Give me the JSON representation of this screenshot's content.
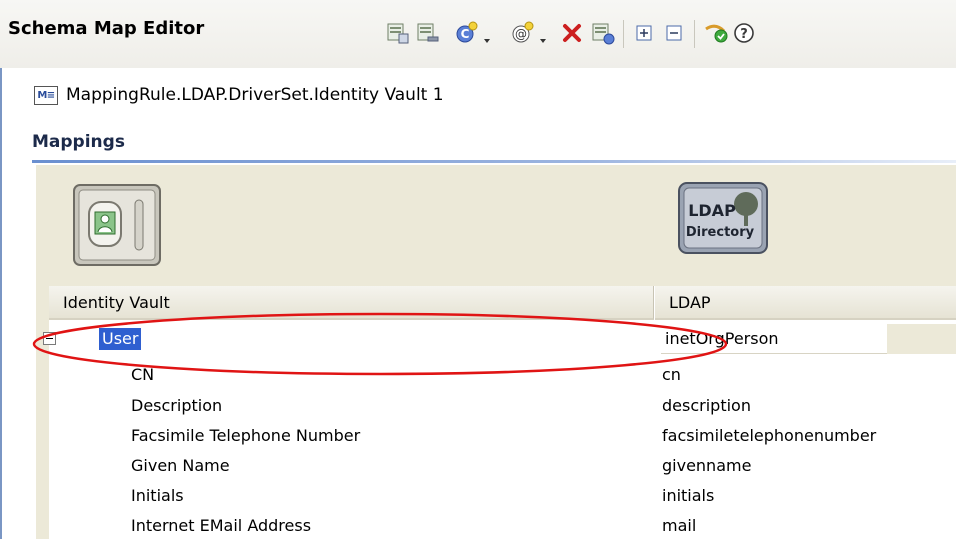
{
  "window": {
    "title": "Schema Map Editor"
  },
  "toolbar": {
    "buttons": [
      {
        "name": "add-class-mapping",
        "icon": "schema-add-icon"
      },
      {
        "name": "remove-class-mapping",
        "icon": "schema-remove-icon"
      },
      {
        "name": "add-class",
        "icon": "class-add-icon"
      },
      {
        "name": "add-attribute",
        "icon": "attribute-add-icon"
      },
      {
        "name": "delete",
        "icon": "delete-icon"
      },
      {
        "name": "refresh-schema",
        "icon": "schema-refresh-icon"
      },
      {
        "name": "expand-all",
        "icon": "plus-box-icon"
      },
      {
        "name": "collapse-all",
        "icon": "minus-box-icon"
      },
      {
        "name": "test-mapping",
        "icon": "check-icon"
      },
      {
        "name": "help",
        "icon": "help-icon"
      }
    ],
    "colors": {
      "delete": "#cc1f1f",
      "help_border": "#3a3a3a"
    }
  },
  "rule": {
    "icon_label": "M≡",
    "name": "MappingRule.LDAP.DriverSet.Identity Vault 1"
  },
  "section": {
    "title": "Mappings"
  },
  "ldap_icon": {
    "line1": "LDAP",
    "line2": "Directory"
  },
  "table": {
    "columns": [
      "Identity Vault",
      "LDAP"
    ],
    "class_row": {
      "vault": "User",
      "ldap": "inetOrgPerson"
    },
    "rows": [
      {
        "vault": "CN",
        "ldap": "cn"
      },
      {
        "vault": "Description",
        "ldap": "description"
      },
      {
        "vault": "Facsimile Telephone Number",
        "ldap": "facsimiletelephonenumber"
      },
      {
        "vault": "Given Name",
        "ldap": "givenname"
      },
      {
        "vault": "Initials",
        "ldap": "initials"
      },
      {
        "vault": "Internet EMail Address",
        "ldap": "mail"
      }
    ]
  },
  "colors": {
    "accent": "#2f5fd0",
    "panel": "#ece9d8",
    "highlight_ellipse": "#e01414"
  }
}
